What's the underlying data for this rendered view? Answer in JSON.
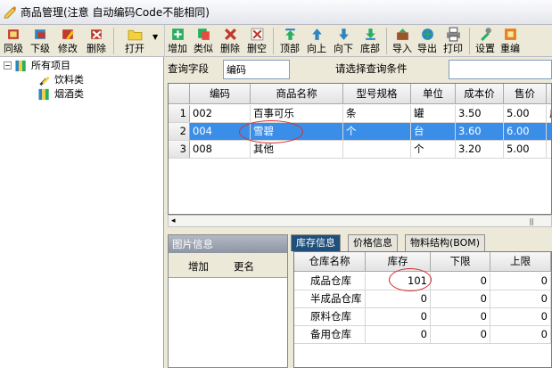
{
  "window": {
    "title": "商品管理(注意 自动编码Code不能相同)"
  },
  "toolbar_left": [
    {
      "label": "同级",
      "icon": "same-level-icon"
    },
    {
      "label": "下级",
      "icon": "sub-level-icon"
    },
    {
      "label": "修改",
      "icon": "edit-icon"
    },
    {
      "label": "删除",
      "icon": "delete-icon"
    },
    {
      "label": "打开",
      "icon": "open-folder-icon"
    }
  ],
  "toolbar_right": [
    {
      "label": "增加",
      "icon": "add-icon"
    },
    {
      "label": "类似",
      "icon": "copy-similar-icon"
    },
    {
      "label": "删除",
      "icon": "delete-icon"
    },
    {
      "label": "删空",
      "icon": "clear-all-icon"
    },
    {
      "label": "顶部",
      "icon": "move-top-icon"
    },
    {
      "label": "向上",
      "icon": "move-up-icon"
    },
    {
      "label": "向下",
      "icon": "move-down-icon"
    },
    {
      "label": "底部",
      "icon": "move-bottom-icon"
    },
    {
      "label": "导入",
      "icon": "import-icon"
    },
    {
      "label": "导出",
      "icon": "export-icon"
    },
    {
      "label": "打印",
      "icon": "print-icon"
    },
    {
      "label": "设置",
      "icon": "settings-icon"
    },
    {
      "label": "重编",
      "icon": "renumber-icon"
    }
  ],
  "tree": {
    "root": {
      "label": "所有项目",
      "toggle": "−"
    },
    "children": [
      {
        "label": "饮料类"
      },
      {
        "label": "烟酒类"
      }
    ]
  },
  "query": {
    "field_label": "查询字段",
    "field_value": "编码",
    "condition_label": "请选择查询条件",
    "condition_value": ""
  },
  "product_table": {
    "columns": [
      "编码",
      "商品名称",
      "型号规格",
      "单位",
      "成本价",
      "售价"
    ],
    "rows": [
      {
        "idx": "1",
        "code": "002",
        "name": "百事可乐",
        "spec": "条",
        "unit": "罐",
        "cost": "3.50",
        "price": "5.00",
        "extra": "广"
      },
      {
        "idx": "2",
        "code": "004",
        "name": "雪碧",
        "spec": "个",
        "unit": "台",
        "cost": "3.60",
        "price": "6.00",
        "extra": ""
      },
      {
        "idx": "3",
        "code": "008",
        "name": "其他",
        "spec": "",
        "unit": "个",
        "cost": "3.20",
        "price": "5.00",
        "extra": ""
      }
    ],
    "selected_row": 1,
    "scroll_left_arrow": "◂",
    "scroll_grip": "|||"
  },
  "image_panel": {
    "title": "图片信息",
    "add_label": "增加",
    "rename_label": "更名"
  },
  "tabs": [
    {
      "label": "库存信息",
      "active": true
    },
    {
      "label": "价格信息",
      "active": false
    },
    {
      "label": "物料结构(BOM)",
      "active": false
    }
  ],
  "stock_table": {
    "columns": [
      "仓库名称",
      "库存",
      "下限",
      "上限"
    ],
    "rows": [
      {
        "warehouse": "成品仓库",
        "stock": "101",
        "min": "0",
        "max": "0"
      },
      {
        "warehouse": "半成品仓库",
        "stock": "0",
        "min": "0",
        "max": "0"
      },
      {
        "warehouse": "原料仓库",
        "stock": "0",
        "min": "0",
        "max": "0"
      },
      {
        "warehouse": "备用仓库",
        "stock": "0",
        "min": "0",
        "max": "0"
      }
    ]
  },
  "colors": {
    "selection": "#3b8ee8",
    "annotation_red": "#d32f2f",
    "tab_active": "#1f4f7a"
  }
}
